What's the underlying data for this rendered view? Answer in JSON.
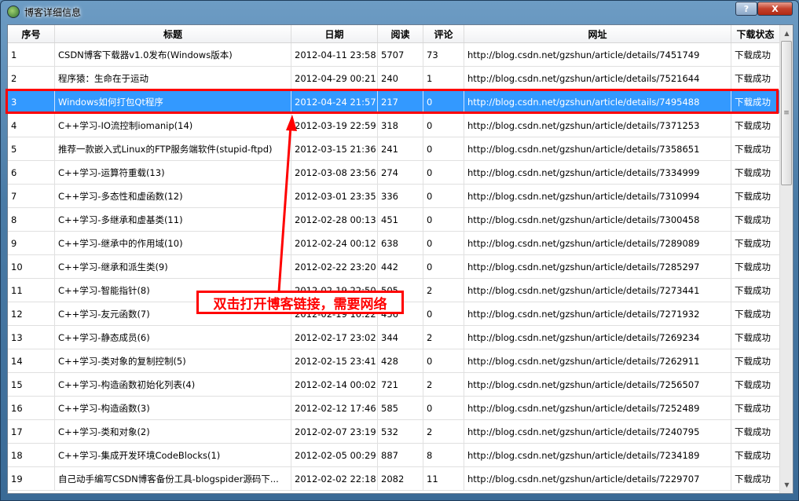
{
  "window": {
    "title": "博客详细信息",
    "help_label": "?",
    "close_label": "X"
  },
  "table": {
    "columns": [
      "序号",
      "标题",
      "日期",
      "阅读",
      "评论",
      "网址",
      "下载状态"
    ],
    "selected_row": 3,
    "rows": [
      [
        "1",
        "CSDN博客下载器v1.0发布(Windows版本)",
        "2012-04-11 23:58",
        "5707",
        "73",
        "http://blog.csdn.net/gzshun/article/details/7451749",
        "下载成功"
      ],
      [
        "2",
        "程序猿：生命在于运动",
        "2012-04-29 00:21",
        "240",
        "1",
        "http://blog.csdn.net/gzshun/article/details/7521644",
        "下载成功"
      ],
      [
        "3",
        "Windows如何打包Qt程序",
        "2012-04-24 21:57",
        "217",
        "0",
        "http://blog.csdn.net/gzshun/article/details/7495488",
        "下载成功"
      ],
      [
        "4",
        "C++学习-IO流控制iomanip(14)",
        "2012-03-19 22:59",
        "318",
        "0",
        "http://blog.csdn.net/gzshun/article/details/7371253",
        "下载成功"
      ],
      [
        "5",
        "推荐一款嵌入式Linux的FTP服务端软件(stupid-ftpd)",
        "2012-03-15 21:36",
        "241",
        "0",
        "http://blog.csdn.net/gzshun/article/details/7358651",
        "下载成功"
      ],
      [
        "6",
        "C++学习-运算符重载(13)",
        "2012-03-08 23:56",
        "274",
        "0",
        "http://blog.csdn.net/gzshun/article/details/7334999",
        "下载成功"
      ],
      [
        "7",
        "C++学习-多态性和虚函数(12)",
        "2012-03-01 23:35",
        "336",
        "0",
        "http://blog.csdn.net/gzshun/article/details/7310994",
        "下载成功"
      ],
      [
        "8",
        "C++学习-多继承和虚基类(11)",
        "2012-02-28 00:13",
        "451",
        "0",
        "http://blog.csdn.net/gzshun/article/details/7300458",
        "下载成功"
      ],
      [
        "9",
        "C++学习-继承中的作用域(10)",
        "2012-02-24 00:12",
        "638",
        "0",
        "http://blog.csdn.net/gzshun/article/details/7289089",
        "下载成功"
      ],
      [
        "10",
        "C++学习-继承和派生类(9)",
        "2012-02-22 23:20",
        "442",
        "0",
        "http://blog.csdn.net/gzshun/article/details/7285297",
        "下载成功"
      ],
      [
        "11",
        "C++学习-智能指针(8)",
        "2012-02-19 22:50",
        "505",
        "2",
        "http://blog.csdn.net/gzshun/article/details/7273441",
        "下载成功"
      ],
      [
        "12",
        "C++学习-友元函数(7)",
        "2012-02-19 10:22",
        "456",
        "0",
        "http://blog.csdn.net/gzshun/article/details/7271932",
        "下载成功"
      ],
      [
        "13",
        "C++学习-静态成员(6)",
        "2012-02-17 23:02",
        "344",
        "2",
        "http://blog.csdn.net/gzshun/article/details/7269234",
        "下载成功"
      ],
      [
        "14",
        "C++学习-类对象的复制控制(5)",
        "2012-02-15 23:41",
        "428",
        "0",
        "http://blog.csdn.net/gzshun/article/details/7262911",
        "下载成功"
      ],
      [
        "15",
        "C++学习-构造函数初始化列表(4)",
        "2012-02-14 00:02",
        "721",
        "2",
        "http://blog.csdn.net/gzshun/article/details/7256507",
        "下载成功"
      ],
      [
        "16",
        "C++学习-构造函数(3)",
        "2012-02-12 17:46",
        "585",
        "0",
        "http://blog.csdn.net/gzshun/article/details/7252489",
        "下载成功"
      ],
      [
        "17",
        "C++学习-类和对象(2)",
        "2012-02-07 23:19",
        "532",
        "2",
        "http://blog.csdn.net/gzshun/article/details/7240795",
        "下载成功"
      ],
      [
        "18",
        "C++学习-集成开发环境CodeBlocks(1)",
        "2012-02-05 00:29",
        "887",
        "8",
        "http://blog.csdn.net/gzshun/article/details/7234189",
        "下载成功"
      ],
      [
        "19",
        "自己动手编写CSDN博客备份工具-blogspider源码下...",
        "2012-02-02 22:18",
        "2082",
        "11",
        "http://blog.csdn.net/gzshun/article/details/7229707",
        "下载成功"
      ]
    ]
  },
  "annotation": {
    "text": "双击打开博客链接，需要网络",
    "color": "#ff0000"
  },
  "colors": {
    "selection": "#3399ff",
    "highlight": "#ff0000"
  }
}
